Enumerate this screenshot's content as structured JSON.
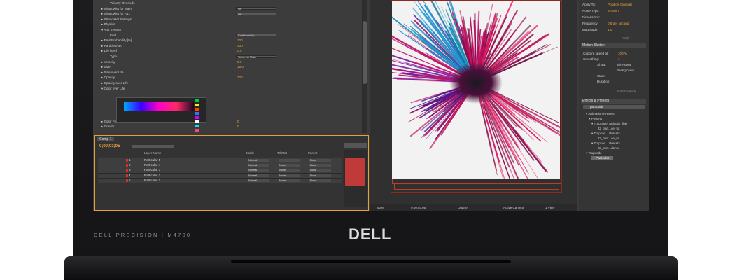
{
  "laptop": {
    "model_label": "DELL PRECISION | M4700",
    "logo": "DELL"
  },
  "properties_panel": {
    "rows": [
      {
        "label": "Velocity Over Life",
        "value": ""
      },
      {
        "label": "▸ Shadowlet for Main",
        "value": "Off"
      },
      {
        "label": "▸ Shadowlet for Aux",
        "value": "Off"
      },
      {
        "label": "▸ Shadowlet Settings",
        "value": ""
      },
      {
        "label": "▸ Physics",
        "value": ""
      },
      {
        "label": "▾ Aux System",
        "value": ""
      },
      {
        "label": "Emit",
        "value": "Continuously"
      },
      {
        "label": "▸ Emit Probability [%]",
        "value": "100"
      },
      {
        "label": "▸ Particles/sec",
        "value": "300"
      },
      {
        "label": "▸ Life [sec]",
        "value": "0.5"
      },
      {
        "label": "Type",
        "value": "Same as Main"
      },
      {
        "label": "▸ Velocity",
        "value": "0.0"
      },
      {
        "label": "▸ Size",
        "value": "15.0"
      },
      {
        "label": "▸ Size over Life",
        "value": ""
      },
      {
        "label": "▸ Opacity",
        "value": "100"
      },
      {
        "label": "▸ Opacity over Life",
        "value": ""
      },
      {
        "label": "▾ Color over Life",
        "value": ""
      },
      {
        "label": "▸ Color From Main [%]",
        "value": "0"
      },
      {
        "label": "▸ Gravity",
        "value": "0"
      }
    ]
  },
  "timeline": {
    "tab": "Comp 1",
    "timecode": "0;00;03;05",
    "column_header": "Layer Name",
    "mode_header": "Mode",
    "trkmat_header": "TrkMat",
    "parent_header": "Parent",
    "layers": [
      {
        "num": "1",
        "name": "Particular 5",
        "mode": "Normal",
        "trkmat": "",
        "parent": "None"
      },
      {
        "num": "2",
        "name": "Particular 4",
        "mode": "Normal",
        "trkmat": "None",
        "parent": "None"
      },
      {
        "num": "3",
        "name": "Particular 3",
        "mode": "Normal",
        "trkmat": "None",
        "parent": "None"
      },
      {
        "num": "4",
        "name": "Particular 2",
        "mode": "Normal",
        "trkmat": "None",
        "parent": "None"
      },
      {
        "num": "5",
        "name": "Particular 1",
        "mode": "Normal",
        "trkmat": "None",
        "parent": "None"
      }
    ]
  },
  "viewer": {
    "zoom": "50%",
    "time": "0;00;03;05",
    "quality": "Quarter",
    "camera": "Active Camera",
    "views": "1 View"
  },
  "right_panels": {
    "top_rows": [
      {
        "label": "Apply To:",
        "value": "Position (Spatial)"
      },
      {
        "label": "Noise Type:",
        "value": "Smooth"
      },
      {
        "label": "Dimensions:",
        "value": ""
      },
      {
        "label": "Frequency:",
        "value": "0.5 per second"
      },
      {
        "label": "Magnitude:",
        "value": "1.0"
      }
    ],
    "apply_label": "Apply",
    "motion_sketch_title": "Motion Sketch",
    "motion_rows": [
      {
        "label": "Capture speed at:",
        "value": "100 %"
      },
      {
        "label": "Smoothing:",
        "value": "1"
      },
      {
        "label": "Show:",
        "value": "Wireframe"
      },
      {
        "label": "",
        "value": "Background"
      },
      {
        "label": "Start:",
        "value": ""
      },
      {
        "label": "Duration:",
        "value": ""
      }
    ],
    "start_capture_label": "Start Capture",
    "effects_title": "Effects & Presets",
    "search_value": "particular",
    "effects_tree": [
      "▾ Animation Presets",
      "▾ Presets",
      "▾ Trapcode_articular fiber",
      "t2_part...ce_txt",
      "▾ Trapcod... Presets",
      "t2_part...ce_txt",
      "▾ Trapcod... Presets",
      "t2_part...dance",
      "▾ Trapcode",
      "Particular"
    ]
  }
}
